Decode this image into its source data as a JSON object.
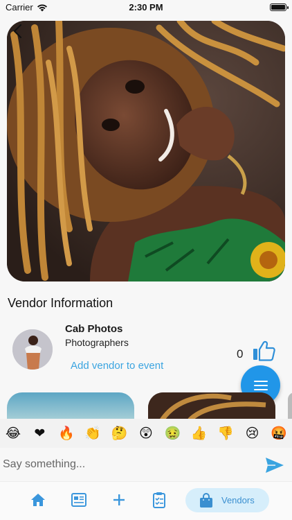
{
  "status_bar": {
    "carrier": "Carrier",
    "time": "2:30 PM"
  },
  "hero": {
    "back_icon": "chevron-left-icon"
  },
  "vendor_section": {
    "title": "Vendor Information",
    "vendor_name": "Cab Photos",
    "vendor_category": "Photographers",
    "add_to_event_label": "Add vendor to event",
    "like_count": "0",
    "like_icon": "thumbs-up-icon"
  },
  "fab": {
    "icon": "menu-icon"
  },
  "emoji_bar": {
    "emojis": [
      "😂",
      "❤",
      "🔥",
      "👏",
      "🤔",
      "😲",
      "🤢",
      "👍",
      "👎",
      "😢",
      "🤬"
    ]
  },
  "comment_input": {
    "placeholder": "Say something...",
    "send_icon": "send-icon"
  },
  "tab_bar": {
    "tabs": [
      {
        "icon": "home-icon"
      },
      {
        "icon": "news-icon"
      },
      {
        "icon": "plus-icon"
      },
      {
        "icon": "checklist-icon"
      },
      {
        "icon": "shopping-bag-icon",
        "label": "Vendors",
        "active": true
      }
    ]
  },
  "colors": {
    "accent": "#2196e8",
    "link": "#3aa4e0",
    "active_tab_bg": "#d6eefb"
  }
}
